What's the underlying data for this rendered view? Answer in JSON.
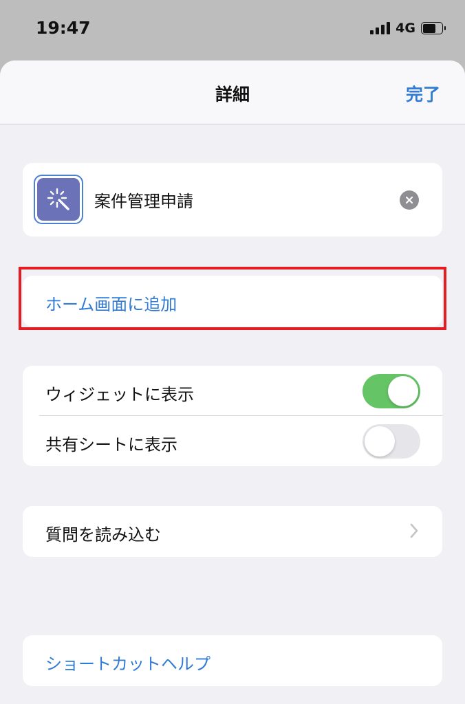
{
  "status_bar": {
    "time": "19:47",
    "network": "4G"
  },
  "nav": {
    "title": "詳細",
    "done_label": "完了"
  },
  "shortcut": {
    "name": "案件管理申請",
    "icon": "magic-wand-icon",
    "icon_color": "#6c72b8"
  },
  "home_screen": {
    "label": "ホーム画面に追加"
  },
  "toggles": [
    {
      "label": "ウィジェットに表示",
      "on": true
    },
    {
      "label": "共有シートに表示",
      "on": false
    }
  ],
  "import_questions": {
    "label": "質問を読み込む"
  },
  "help": {
    "label": "ショートカットヘルプ"
  },
  "colors": {
    "accent": "#2f7bd5",
    "toggle_on": "#65c466",
    "highlight": "#e21e24"
  }
}
